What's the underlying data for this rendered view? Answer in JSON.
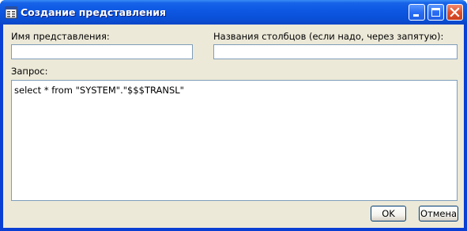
{
  "window": {
    "title": "Создание представления",
    "title_icon": "app-window-icon",
    "controls": {
      "minimize_icon": "minimize-icon",
      "maximize_icon": "maximize-icon",
      "close_icon": "close-icon"
    }
  },
  "form": {
    "view_name": {
      "label": "Имя представления:",
      "value": ""
    },
    "column_names": {
      "label": "Названия столбцов (если надо, через запятую):",
      "value": ""
    },
    "query": {
      "label": "Запрос:",
      "value": "select * from \"SYSTEM\".\"$$$TRANSL\""
    }
  },
  "buttons": {
    "ok_label": "OK",
    "cancel_label": "Отмена"
  },
  "colors": {
    "titlebar": "#0a4fd6",
    "client_background": "#ece9d8",
    "input_border": "#7f9db9",
    "close_button": "#e0502b"
  }
}
